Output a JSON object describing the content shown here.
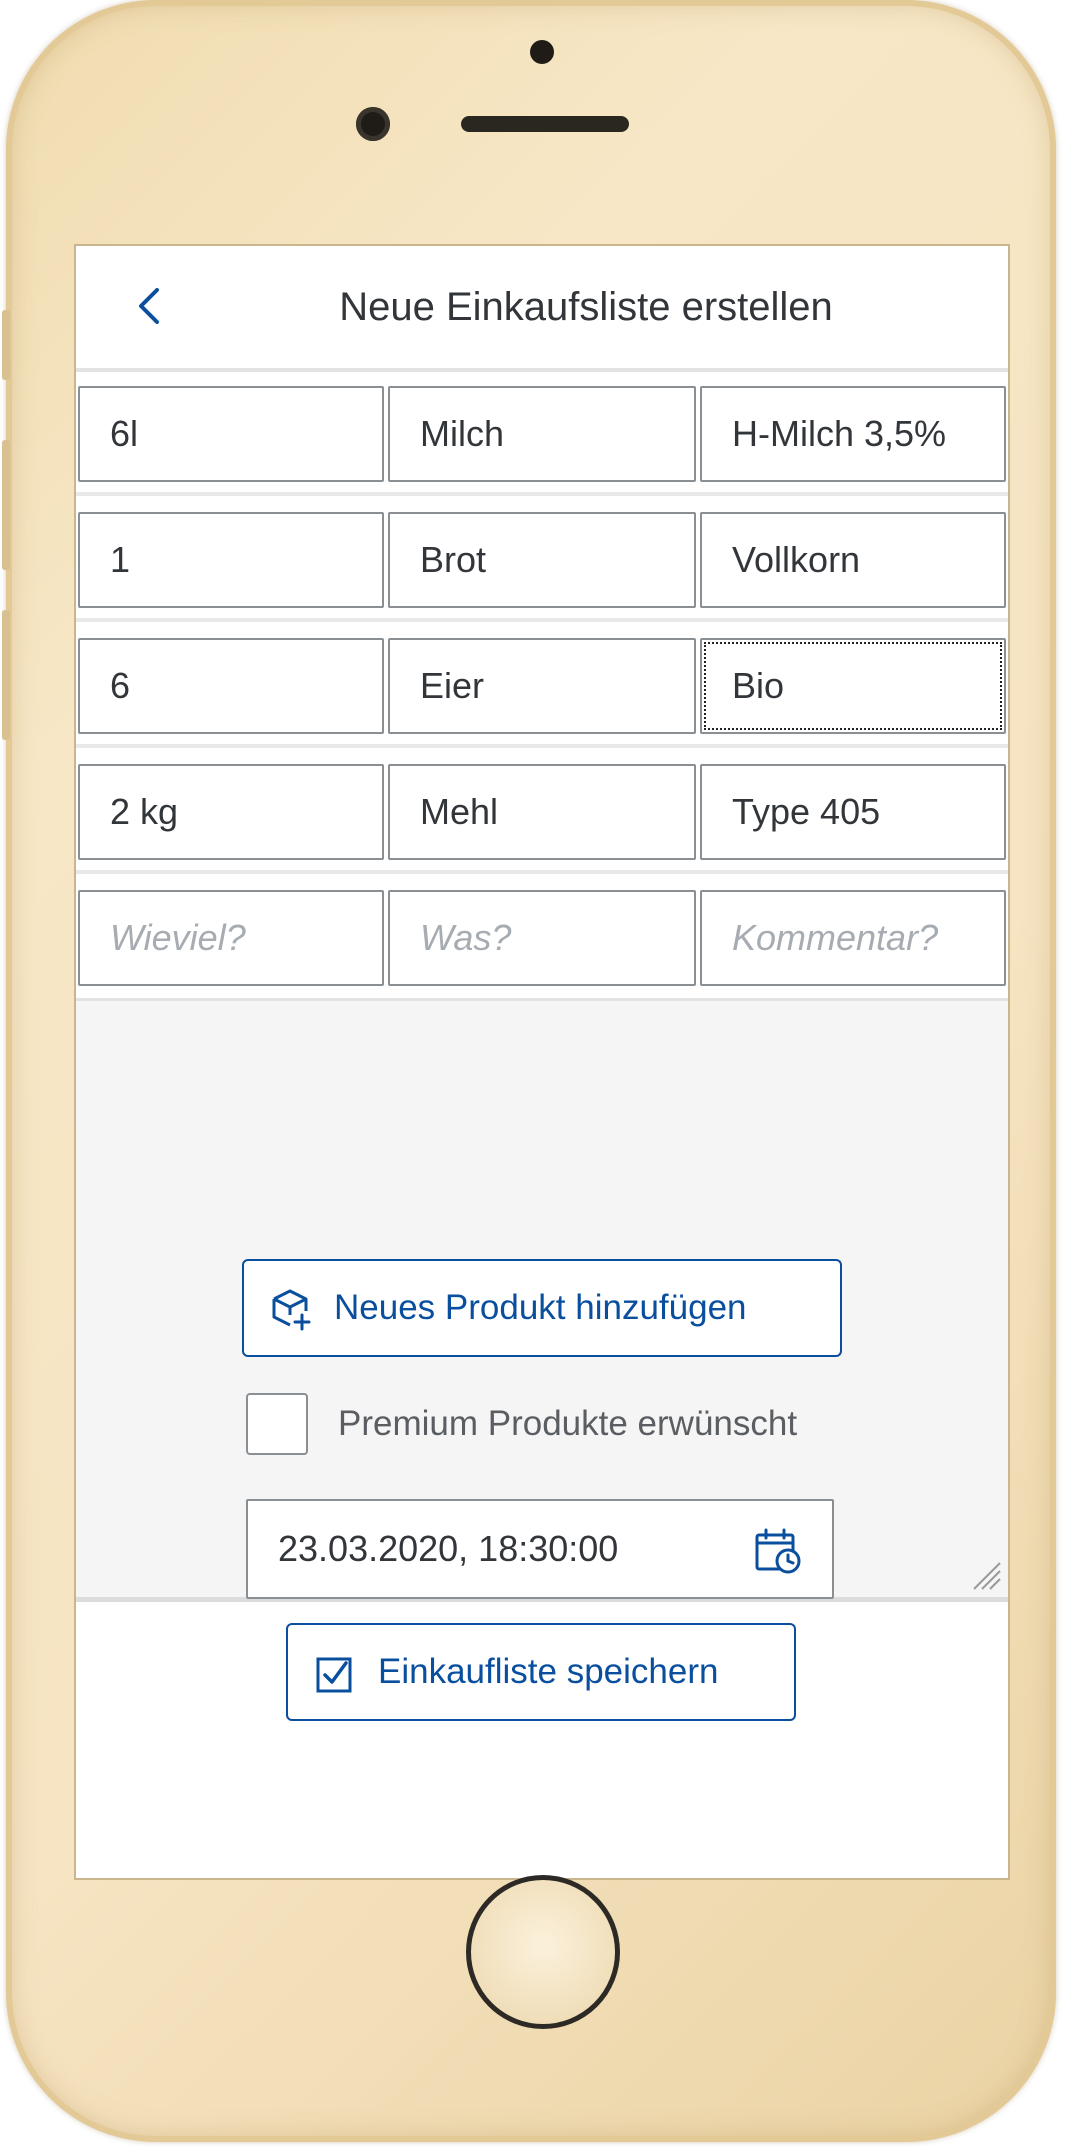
{
  "header": {
    "back_icon": "chevron-left-icon",
    "title": "Neue Einkaufsliste erstellen"
  },
  "rows": [
    {
      "amount": "6l",
      "item": "Milch",
      "comment": "H-Milch 3,5%"
    },
    {
      "amount": "1",
      "item": "Brot",
      "comment": "Vollkorn"
    },
    {
      "amount": "6",
      "item": "Eier",
      "comment": "Bio"
    },
    {
      "amount": "2 kg",
      "item": "Mehl",
      "comment": "Type 405"
    }
  ],
  "new_row": {
    "amount_placeholder": "Wieviel?",
    "item_placeholder": "Was?",
    "comment_placeholder": "Kommentar?"
  },
  "actions": {
    "add_product_label": "Neues Produkt hinzufügen",
    "add_product_icon": "add-product-icon",
    "premium_label": "Premium Produkte erwünscht",
    "premium_checked": false,
    "datetime_value": "23.03.2020, 18:30:00",
    "datetime_icon": "calendar-clock-icon",
    "save_label": "Einkaufliste speichern",
    "save_icon": "checkbox-checked-icon"
  },
  "colors": {
    "accent": "#0a4f9e",
    "text": "#32363a",
    "placeholder": "#a6acb2",
    "phone_body": "#f6e4c2"
  }
}
